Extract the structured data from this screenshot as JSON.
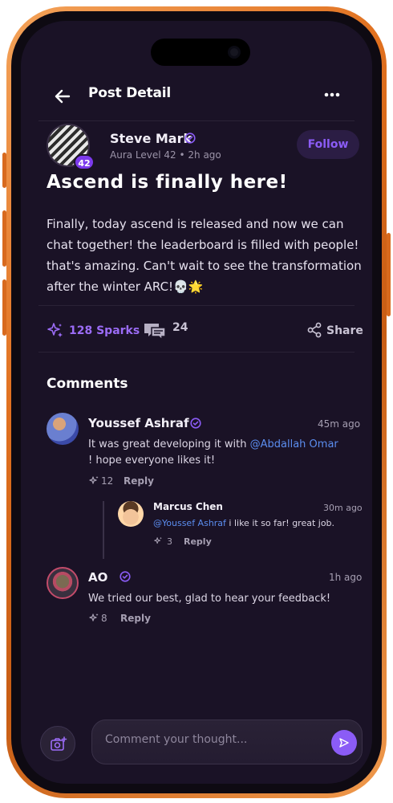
{
  "header": {
    "title": "Post Detail"
  },
  "post": {
    "author": {
      "name": "Steve Mark",
      "meta": "Aura Level 42 • 2h ago",
      "level": "42"
    },
    "follow_label": "Follow",
    "title": "Ascend is finally here!",
    "body": "Finally, today ascend is released and now we can chat together! the leaderboard is filled with people! that's amazing. Can't wait to see the transformation after the winter ARC!💀🌟",
    "sparks_label": "128 Sparks",
    "comment_count": "24",
    "share_label": "Share"
  },
  "comments_title": "Comments",
  "comments": [
    {
      "name": "Youssef Ashraf",
      "time": "45m ago",
      "text_before": "It was great developing it with ",
      "mention": "@Abdallah Omar",
      "text_after": " ! hope everyone likes it!",
      "sparks": "12",
      "reply_label": "Reply",
      "replies": [
        {
          "name": "Marcus Chen",
          "time": "30m ago",
          "mention": "@Youssef Ashraf",
          "text_after": " i like it so far! great job.",
          "sparks": "3",
          "reply_label": "Reply"
        }
      ]
    },
    {
      "name": "AO",
      "time": "1h ago",
      "text": "We tried our best, glad to hear your feedback!",
      "sparks": "8",
      "reply_label": "Reply"
    }
  ],
  "composer": {
    "placeholder": "Comment your thought..."
  },
  "colors": {
    "accent": "#8b5cf6",
    "background": "#1a1226",
    "mention": "#5b8def",
    "frame": "#e0701f"
  }
}
